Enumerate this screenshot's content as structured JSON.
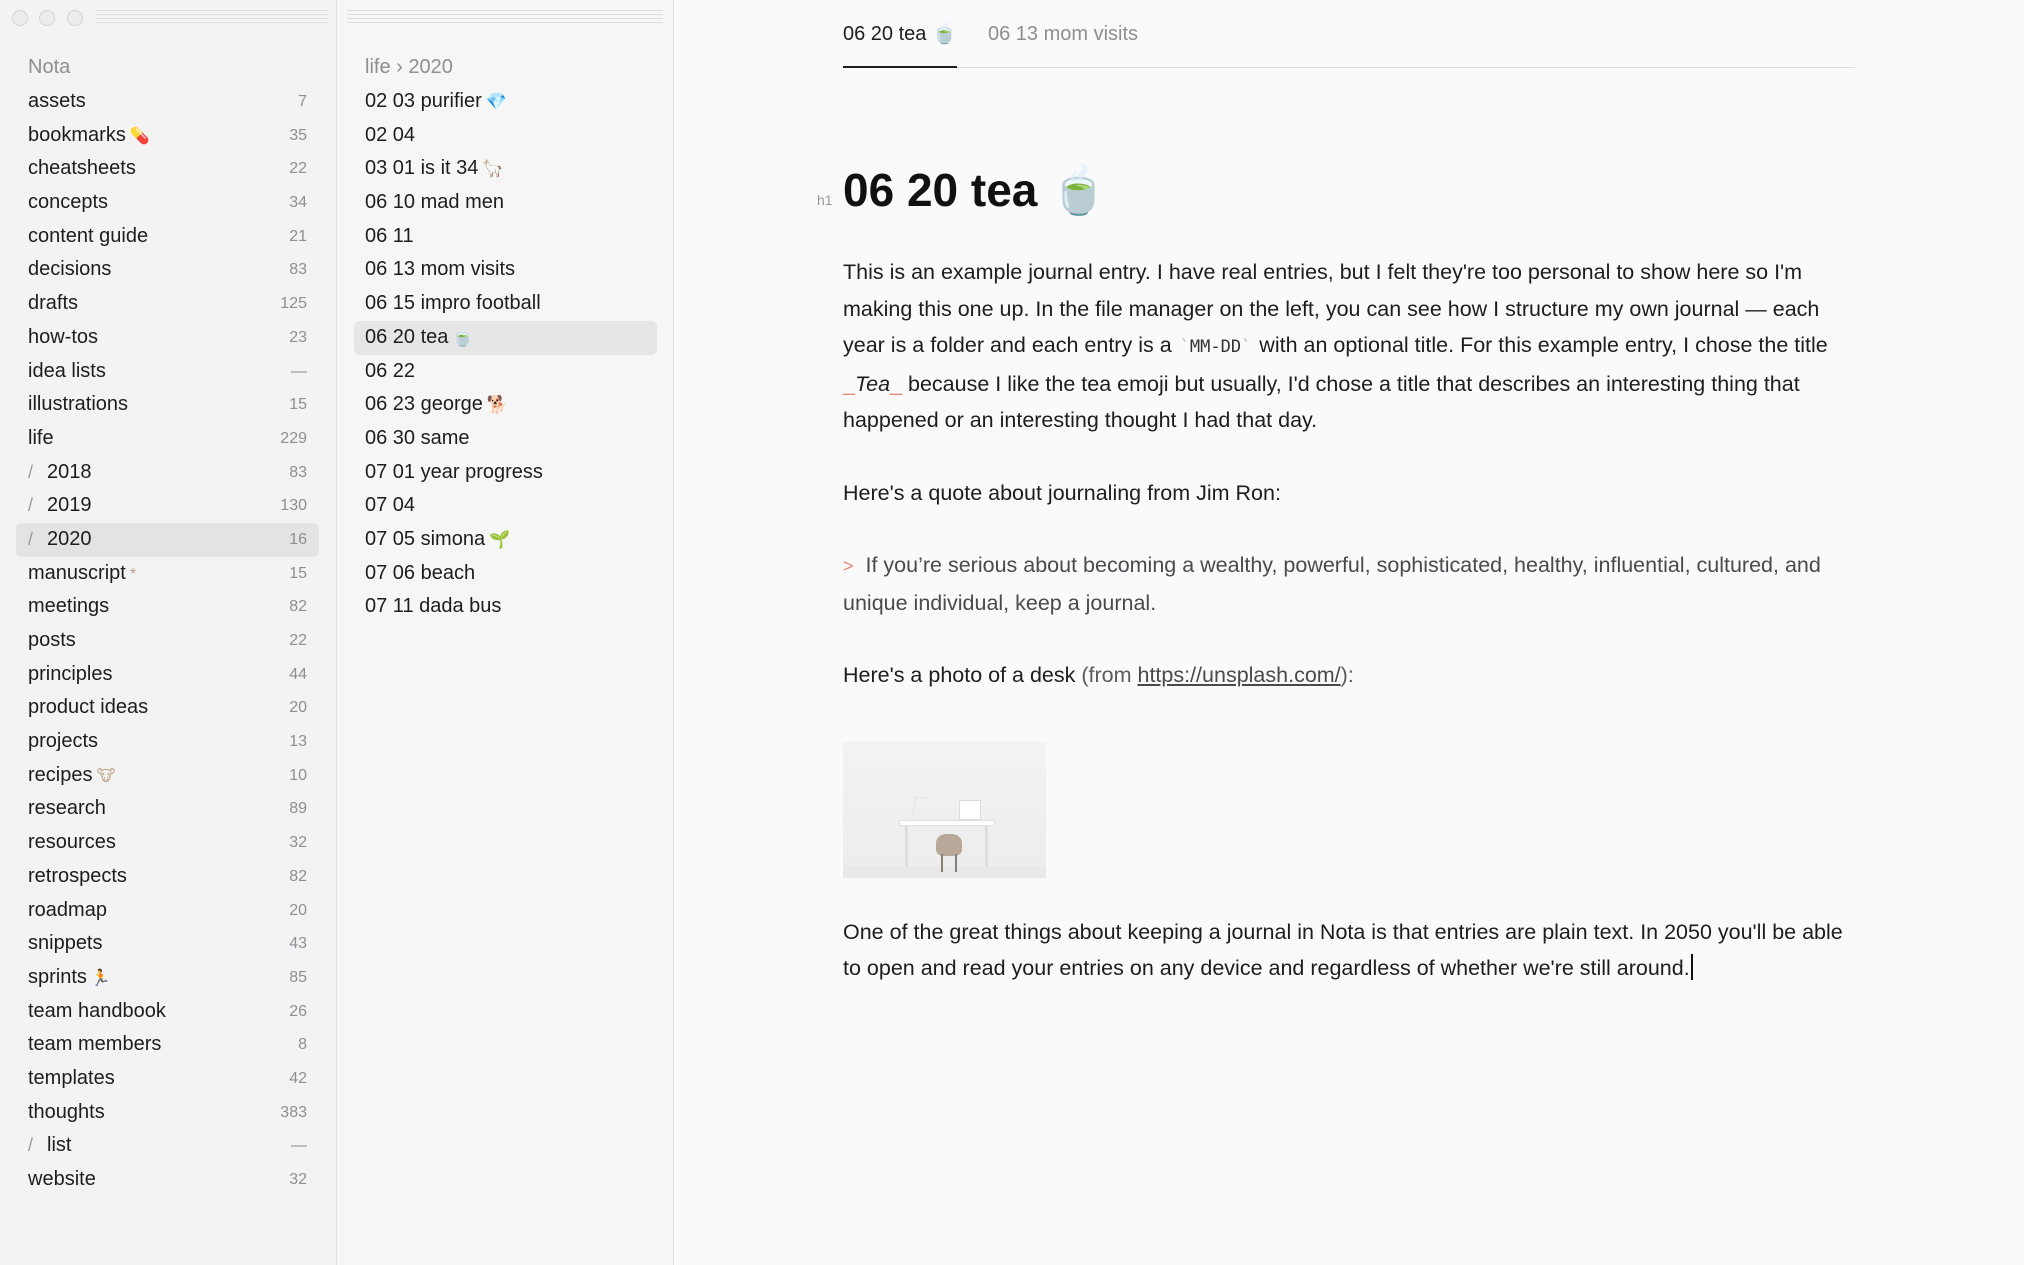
{
  "sidebar": {
    "root": "Nota",
    "folders": [
      {
        "label": "assets",
        "count": "7"
      },
      {
        "label": "bookmarks",
        "count": "35",
        "emoji": "💊"
      },
      {
        "label": "cheatsheets",
        "count": "22"
      },
      {
        "label": "concepts",
        "count": "34"
      },
      {
        "label": "content guide",
        "count": "21"
      },
      {
        "label": "decisions",
        "count": "83"
      },
      {
        "label": "drafts",
        "count": "125"
      },
      {
        "label": "how-tos",
        "count": "23"
      },
      {
        "label": "idea lists",
        "count": "—"
      },
      {
        "label": "illustrations",
        "count": "15"
      },
      {
        "label": "life",
        "count": "229"
      },
      {
        "label": "2018",
        "count": "83",
        "sub": true
      },
      {
        "label": "2019",
        "count": "130",
        "sub": true
      },
      {
        "label": "2020",
        "count": "16",
        "sub": true,
        "selected": true
      },
      {
        "label": "manuscript",
        "count": "15",
        "emoji": "*"
      },
      {
        "label": "meetings",
        "count": "82"
      },
      {
        "label": "posts",
        "count": "22"
      },
      {
        "label": "principles",
        "count": "44"
      },
      {
        "label": "product ideas",
        "count": "20"
      },
      {
        "label": "projects",
        "count": "13"
      },
      {
        "label": "recipes",
        "count": "10",
        "emoji": "🐮"
      },
      {
        "label": "research",
        "count": "89"
      },
      {
        "label": "resources",
        "count": "32"
      },
      {
        "label": "retrospects",
        "count": "82"
      },
      {
        "label": "roadmap",
        "count": "20"
      },
      {
        "label": "snippets",
        "count": "43"
      },
      {
        "label": "sprints",
        "count": "85",
        "emoji": "🏃"
      },
      {
        "label": "team handbook",
        "count": "26"
      },
      {
        "label": "team members",
        "count": "8"
      },
      {
        "label": "templates",
        "count": "42"
      },
      {
        "label": "thoughts",
        "count": "383"
      },
      {
        "label": "list",
        "count": "—",
        "sub": true
      },
      {
        "label": "website",
        "count": "32"
      }
    ]
  },
  "filelist": {
    "breadcrumb": "life › 2020",
    "files": [
      {
        "label": "02 03 purifier",
        "emoji": "💎"
      },
      {
        "label": "02 04"
      },
      {
        "label": "03 01 is it 34",
        "emoji": "🦙"
      },
      {
        "label": "06 10 mad men"
      },
      {
        "label": "06 11"
      },
      {
        "label": "06 13 mom visits"
      },
      {
        "label": "06 15 impro football"
      },
      {
        "label": "06 20 tea",
        "emoji": "🍵",
        "selected": true
      },
      {
        "label": "06 22"
      },
      {
        "label": "06 23 george",
        "emoji": "🐕"
      },
      {
        "label": "06 30 same"
      },
      {
        "label": "07 01 year progress"
      },
      {
        "label": "07 04"
      },
      {
        "label": "07 05 simona",
        "emoji": "🌱"
      },
      {
        "label": "07 06 beach"
      },
      {
        "label": "07 11 dada bus"
      }
    ]
  },
  "editor": {
    "tabs": [
      {
        "label": "06 20 tea 🍵",
        "active": true
      },
      {
        "label": "06 13 mom visits"
      }
    ],
    "h1_marker": "h1",
    "title": "06 20 tea 🍵",
    "p1_a": "This is an example journal entry. I have real entries, but I felt they're too personal to show here so I'm making this one up. In the file manager on the left, you can see how I structure my own journal — each year is a folder and each entry is a ",
    "p1_code": "MM-DD",
    "p1_b": " with an optional title. For this example entry, I chose the title ",
    "p1_em": "Tea",
    "p1_c": " because I like the tea emoji but usually, I'd chose a title that describes an interesting thing that happened or an interesting thought I had that day.",
    "p2": "Here's a quote about journaling from Jim Ron:",
    "quote_marker": ">",
    "quote": "If you’re serious about becoming a wealthy, powerful, sophisticated, healthy, influential, cultured, and unique individual, keep a journal.",
    "p3_a": "Here's a photo of a desk",
    "p3_b": " (from ",
    "p3_link": "https://unsplash.com/",
    "p3_c": "):",
    "p4": "One of the great things about keeping a journal in Nota is that entries are plain text. In 2050 you'll be able to open and read your entries on any device and regardless of whether we're still around."
  }
}
